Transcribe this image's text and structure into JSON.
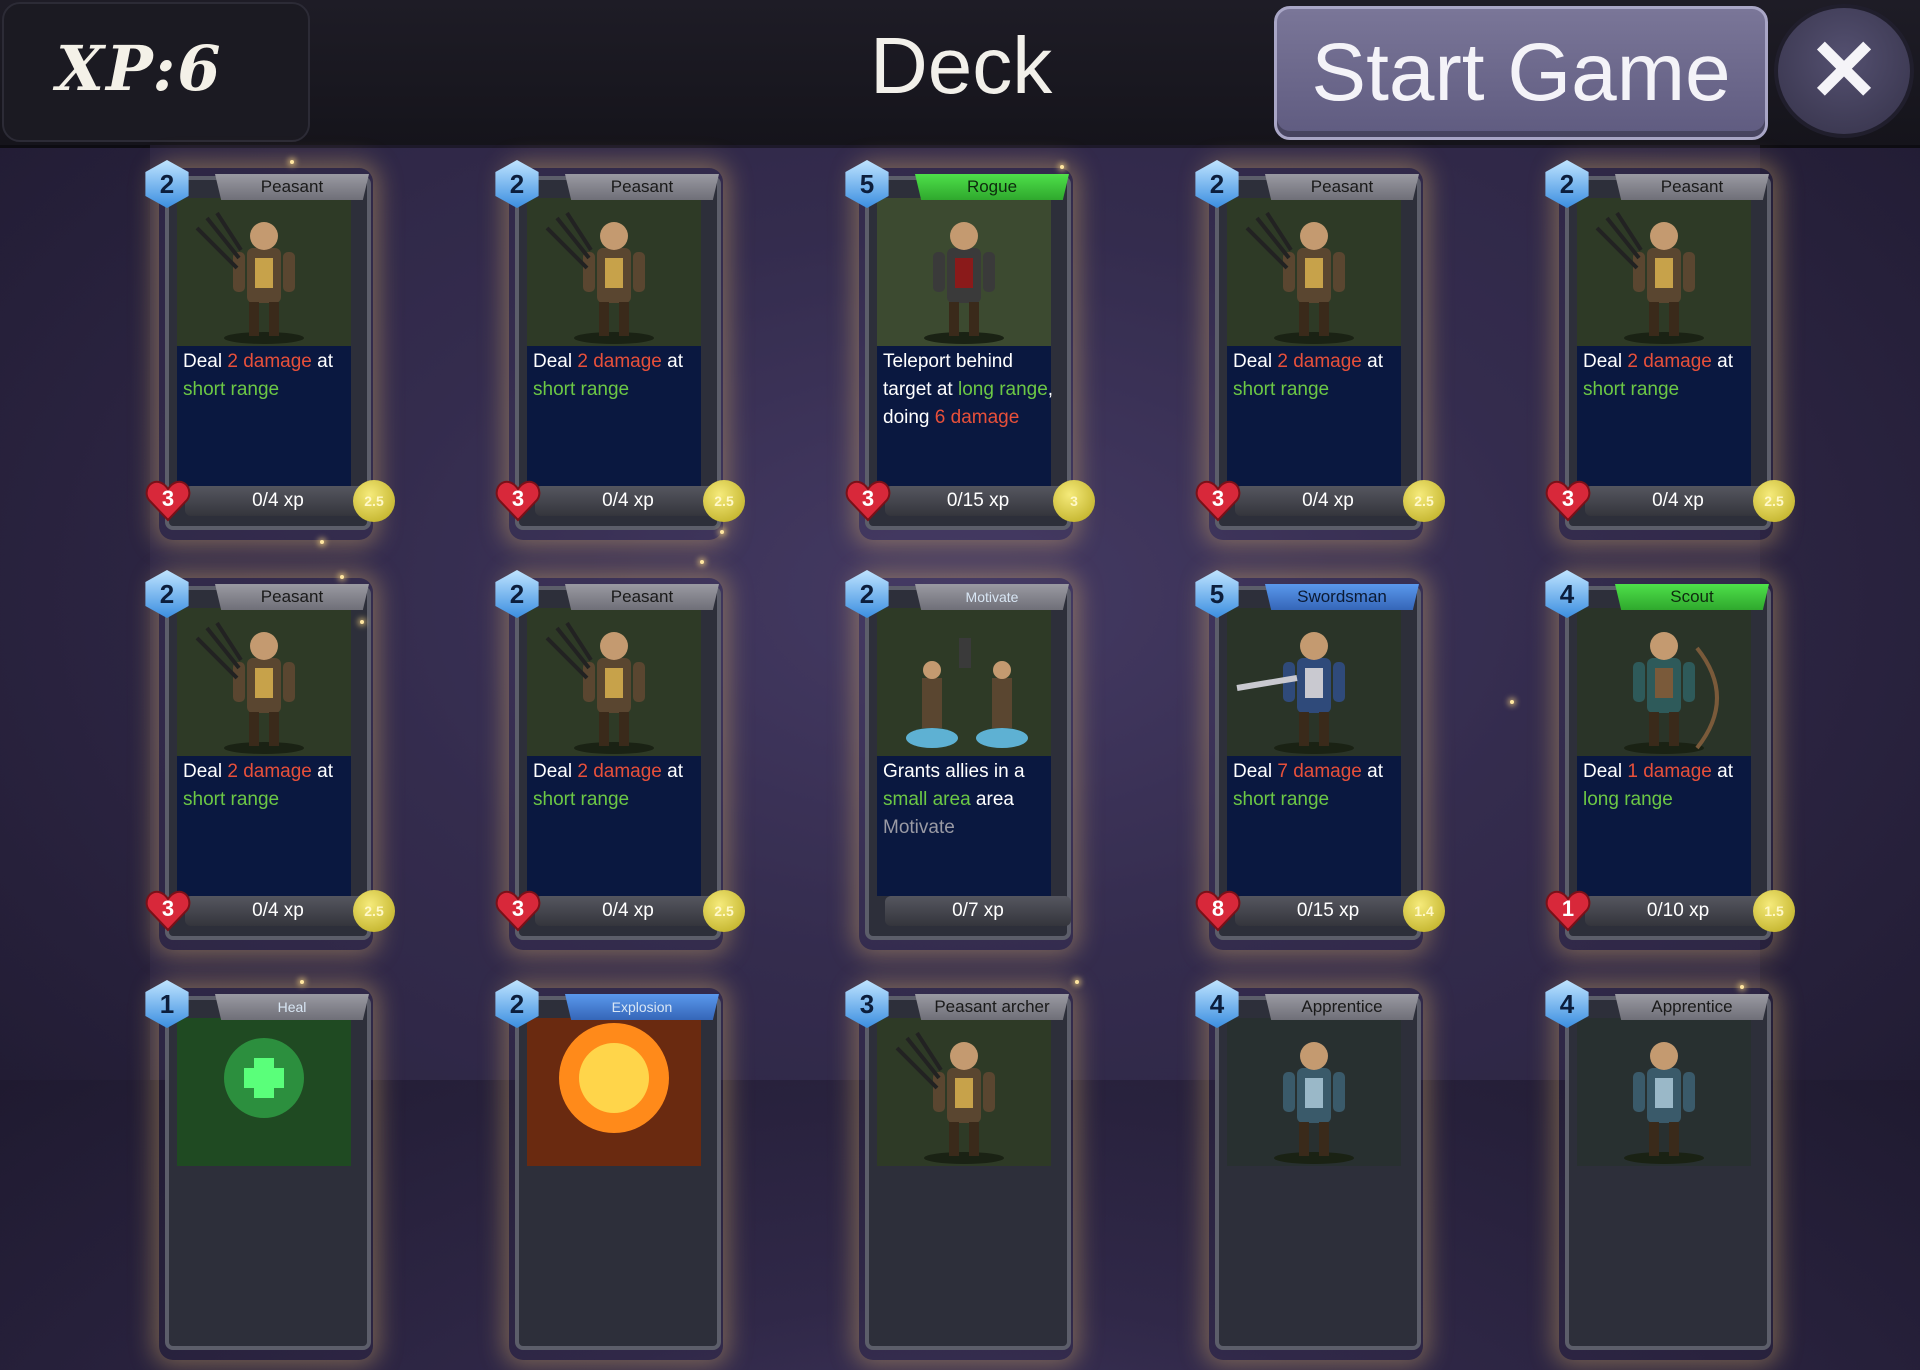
{
  "header": {
    "xp_label": "XP:6",
    "title": "Deck",
    "start_label": "Start Game",
    "close_label": "✕"
  },
  "cards": [
    {
      "name": "Peasant",
      "level": "2",
      "banner": "grey",
      "desc": [
        [
          "Deal ",
          "w"
        ],
        [
          "2 damage",
          "r"
        ],
        [
          " at ",
          "w"
        ],
        [
          "short range",
          "g"
        ]
      ],
      "xp": "0/4 xp",
      "health": "3",
      "speed": "2.5",
      "art": "peasant"
    },
    {
      "name": "Peasant",
      "level": "2",
      "banner": "grey",
      "desc": [
        [
          "Deal ",
          "w"
        ],
        [
          "2 damage",
          "r"
        ],
        [
          " at ",
          "w"
        ],
        [
          "short range",
          "g"
        ]
      ],
      "xp": "0/4 xp",
      "health": "3",
      "speed": "2.5",
      "art": "peasant"
    },
    {
      "name": "Rogue",
      "level": "5",
      "banner": "green",
      "desc": [
        [
          "Teleport behind target at ",
          "w"
        ],
        [
          "long range",
          "g"
        ],
        [
          ", doing ",
          "w"
        ],
        [
          "6 damage",
          "r"
        ]
      ],
      "xp": "0/15 xp",
      "health": "3",
      "speed": "3",
      "art": "rogue"
    },
    {
      "name": "Peasant",
      "level": "2",
      "banner": "grey",
      "desc": [
        [
          "Deal ",
          "w"
        ],
        [
          "2 damage",
          "r"
        ],
        [
          " at ",
          "w"
        ],
        [
          "short range",
          "g"
        ]
      ],
      "xp": "0/4 xp",
      "health": "3",
      "speed": "2.5",
      "art": "peasant"
    },
    {
      "name": "Peasant",
      "level": "2",
      "banner": "grey",
      "desc": [
        [
          "Deal ",
          "w"
        ],
        [
          "2 damage",
          "r"
        ],
        [
          " at ",
          "w"
        ],
        [
          "short range",
          "g"
        ]
      ],
      "xp": "0/4 xp",
      "health": "3",
      "speed": "2.5",
      "art": "peasant"
    },
    {
      "name": "Peasant",
      "level": "2",
      "banner": "grey",
      "desc": [
        [
          "Deal ",
          "w"
        ],
        [
          "2 damage",
          "r"
        ],
        [
          " at ",
          "w"
        ],
        [
          "short range",
          "g"
        ]
      ],
      "xp": "0/4 xp",
      "health": "3",
      "speed": "2.5",
      "art": "peasant"
    },
    {
      "name": "Peasant",
      "level": "2",
      "banner": "grey",
      "desc": [
        [
          "Deal ",
          "w"
        ],
        [
          "2 damage",
          "r"
        ],
        [
          " at ",
          "w"
        ],
        [
          "short range",
          "g"
        ]
      ],
      "xp": "0/4 xp",
      "health": "3",
      "speed": "2.5",
      "art": "peasant"
    },
    {
      "name": "Motivate",
      "level": "2",
      "banner": "grey-small",
      "desc": [
        [
          "Grants allies in a ",
          "w"
        ],
        [
          "small area",
          "g"
        ],
        [
          " area ",
          "w"
        ],
        [
          "Motivate",
          "x"
        ]
      ],
      "xp": "0/7 xp",
      "health": "",
      "speed": "",
      "art": "motivate"
    },
    {
      "name": "Swordsman",
      "level": "5",
      "banner": "blue",
      "desc": [
        [
          "Deal ",
          "w"
        ],
        [
          "7 damage",
          "r"
        ],
        [
          " at ",
          "w"
        ],
        [
          "short range",
          "g"
        ]
      ],
      "xp": "0/15 xp",
      "health": "8",
      "speed": "1.4",
      "art": "swordsman"
    },
    {
      "name": "Scout",
      "level": "4",
      "banner": "green",
      "desc": [
        [
          "Deal ",
          "w"
        ],
        [
          "1 damage",
          "r"
        ],
        [
          " at ",
          "w"
        ],
        [
          "long range",
          "g"
        ]
      ],
      "xp": "0/10 xp",
      "health": "1",
      "speed": "1.5",
      "art": "scout"
    },
    {
      "name": "Heal",
      "level": "1",
      "banner": "grey-small",
      "desc": [],
      "xp": "",
      "health": "",
      "speed": "",
      "art": "heal"
    },
    {
      "name": "Explosion",
      "level": "2",
      "banner": "blue-small",
      "desc": [],
      "xp": "",
      "health": "",
      "speed": "",
      "art": "explosion"
    },
    {
      "name": "Peasant archer",
      "level": "3",
      "banner": "grey",
      "desc": [],
      "xp": "",
      "health": "",
      "speed": "",
      "art": "peasant"
    },
    {
      "name": "Apprentice",
      "level": "4",
      "banner": "grey",
      "desc": [],
      "xp": "",
      "health": "",
      "speed": "",
      "art": "apprentice"
    },
    {
      "name": "Apprentice",
      "level": "4",
      "banner": "grey",
      "desc": [],
      "xp": "",
      "health": "",
      "speed": "",
      "art": "apprentice"
    }
  ]
}
